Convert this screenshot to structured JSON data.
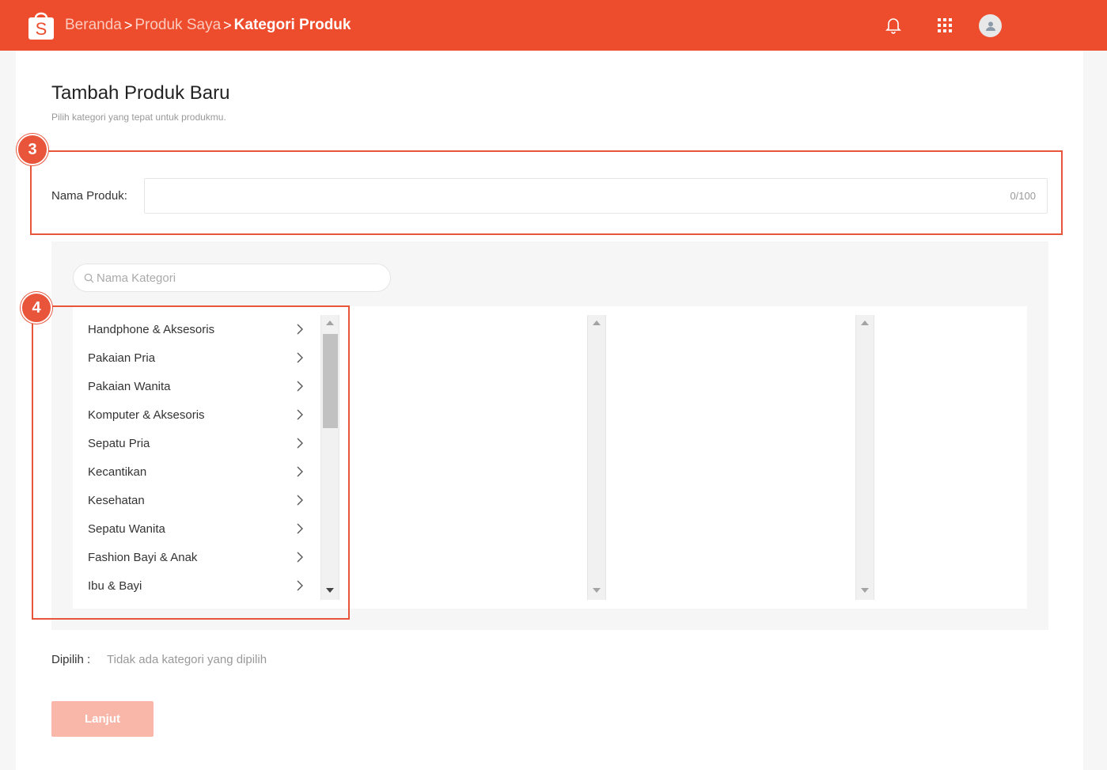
{
  "header": {
    "breadcrumb": [
      "Beranda",
      "Produk Saya",
      "Kategori Produk"
    ],
    "separator": ">",
    "logo_letter": "S",
    "icons": [
      "bell-icon",
      "apps-grid-icon",
      "user-avatar-icon"
    ],
    "brand_color": "#ee4d2d"
  },
  "page": {
    "title": "Tambah Produk Baru",
    "subtitle": "Pilih kategori yang tepat untuk produkmu."
  },
  "callouts": {
    "step3": "3",
    "step4": "4",
    "color": "#e8553b"
  },
  "product_name": {
    "label": "Nama Produk:",
    "value": "",
    "counter": "0/100"
  },
  "category": {
    "search_placeholder": "Nama Kategori",
    "items": [
      "Handphone & Aksesoris",
      "Pakaian Pria",
      "Pakaian Wanita",
      "Komputer & Aksesoris",
      "Sepatu Pria",
      "Kecantikan",
      "Kesehatan",
      "Sepatu Wanita",
      "Fashion Bayi & Anak",
      "Ibu & Bayi"
    ]
  },
  "selected": {
    "label": "Dipilih :",
    "value": "Tidak ada kategori yang dipilih"
  },
  "actions": {
    "next_label": "Lanjut"
  }
}
